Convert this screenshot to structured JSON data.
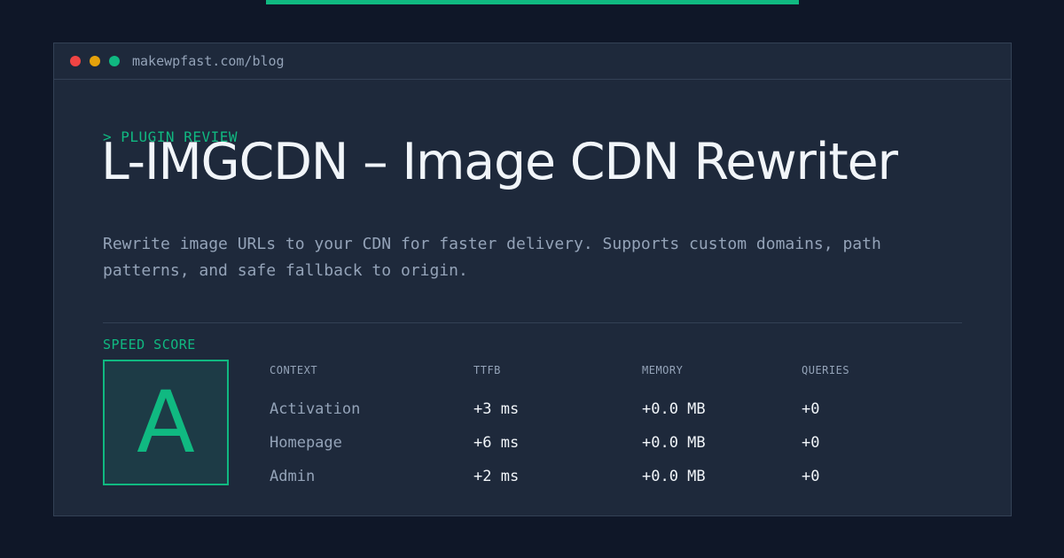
{
  "window": {
    "url": "makewpfast.com/blog"
  },
  "article": {
    "kicker": "> PLUGIN REVIEW",
    "title": "L-IMGCDN – Image CDN Rewriter",
    "description": "Rewrite image URLs to your CDN for faster delivery. Supports custom domains, path patterns, and safe fallback to origin."
  },
  "score": {
    "label": "SPEED SCORE",
    "grade": "A"
  },
  "metrics": {
    "headers": [
      "CONTEXT",
      "TTFB",
      "MEMORY",
      "QUERIES"
    ],
    "rows": [
      [
        "Activation",
        "+3 ms",
        "+0.0 MB",
        "+0"
      ],
      [
        "Homepage",
        "+6 ms",
        "+0.0 MB",
        "+0"
      ],
      [
        "Admin",
        "+2 ms",
        "+0.0 MB",
        "+0"
      ]
    ]
  },
  "colors": {
    "accent": "#10b981",
    "background": "#0f1728",
    "card": "#1e293b",
    "text": "#f1f5f9",
    "muted": "#94a3b8"
  },
  "icons": [
    "close-dot-icon",
    "minimize-dot-icon",
    "maximize-dot-icon"
  ]
}
